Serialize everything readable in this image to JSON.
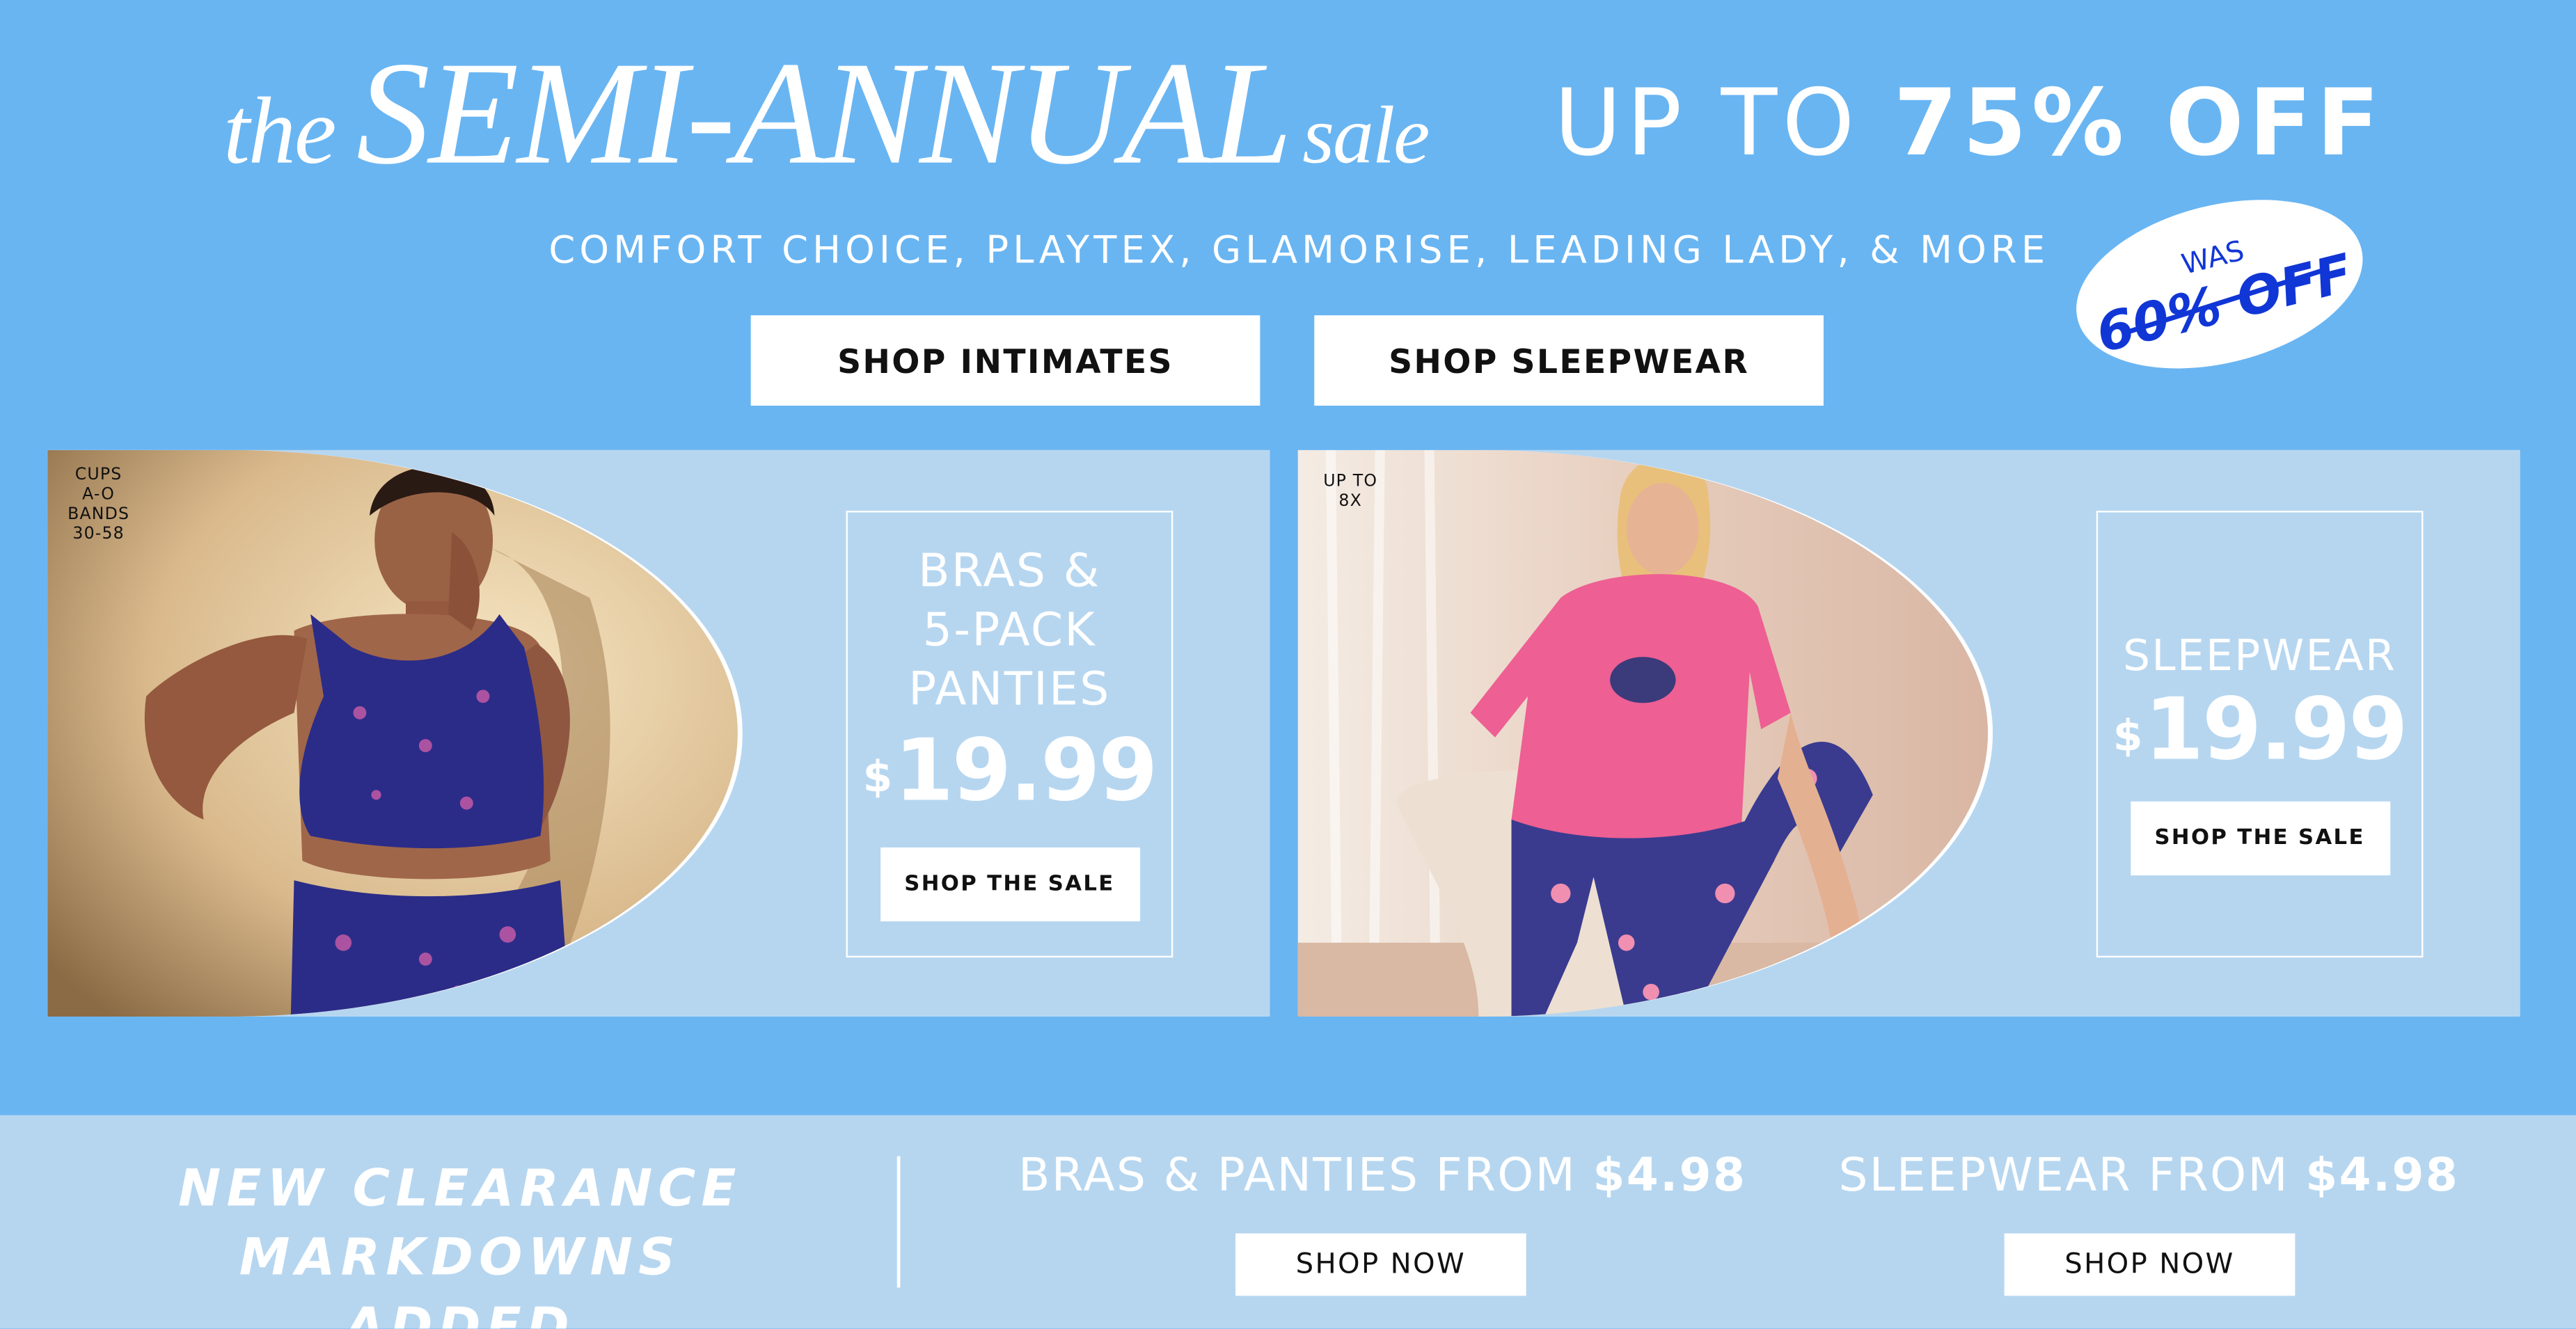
{
  "header": {
    "title_the": "the",
    "title_main": "SEMI-ANNUAL",
    "title_sale": "sale",
    "discount_light": "UP TO",
    "discount_bold": "75% OFF",
    "brands": "COMFORT CHOICE, PLAYTEX, GLAMORISE, LEADING LADY, & MORE",
    "badge_top": "WAS",
    "badge_bottom": "60% OFF"
  },
  "buttons": {
    "intimates": "SHOP INTIMATES",
    "sleepwear": "SHOP SLEEPWEAR"
  },
  "panel_bras": {
    "tag": [
      "CUPS",
      "A-O",
      "BANDS",
      "30-58"
    ],
    "lines": [
      "BRAS &",
      "5-PACK",
      "PANTIES"
    ],
    "currency": "$",
    "price": "19.99",
    "cta": "SHOP THE SALE"
  },
  "panel_sleep": {
    "tag": [
      "UP TO",
      "8X"
    ],
    "label": "SLEEPWEAR",
    "currency": "$",
    "price": "19.99",
    "cta": "SHOP THE SALE"
  },
  "clearance": {
    "line1": "NEW CLEARANCE",
    "line2": "MARKDOWNS ADDED",
    "bras_text": "BRAS & PANTIES FROM",
    "bras_price": "$4.98",
    "bras_cta": "SHOP NOW",
    "sleep_text": "SLEEPWEAR FROM",
    "sleep_price": "$4.98",
    "sleep_cta": "SHOP NOW"
  },
  "colors": {
    "background": "#69b5f2",
    "panel": "#b6d6f0",
    "badge_text": "#1136d6"
  }
}
